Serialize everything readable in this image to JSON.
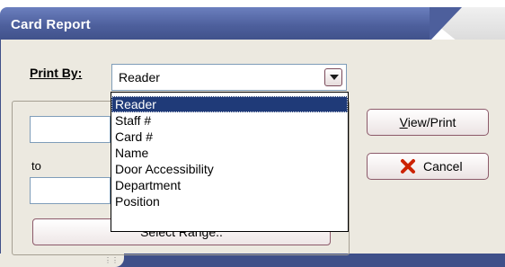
{
  "window": {
    "title": "Card Report"
  },
  "print_by": {
    "label": "Print By:",
    "selected": "Reader",
    "options": [
      "Reader",
      "Staff #",
      "Card #",
      "Name",
      "Door Accessibility",
      "Department",
      "Position"
    ]
  },
  "range": {
    "to_label": "to",
    "from_value": "",
    "to_value": "",
    "select_range_label": "Select Range.."
  },
  "buttons": {
    "view_print_prefix": "V",
    "view_print_rest": "iew/Print",
    "cancel_label": "Cancel"
  },
  "colors": {
    "title_bar": "#4d5f9c",
    "selected_item": "#1f3a78",
    "cancel_icon": "#cc2200"
  }
}
